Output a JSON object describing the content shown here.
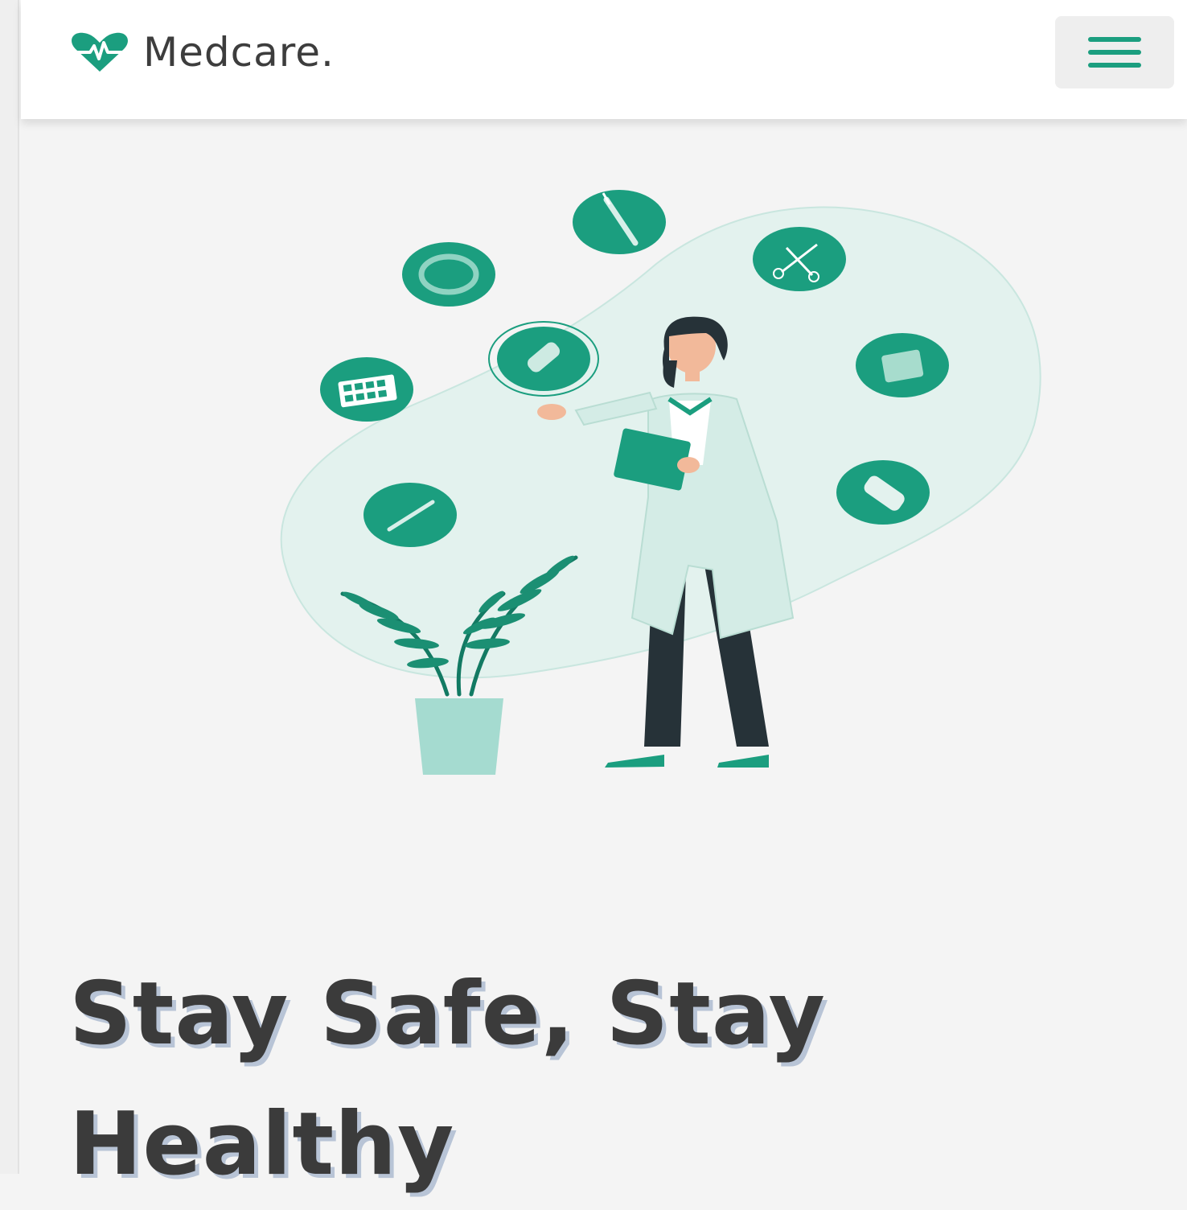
{
  "brand": {
    "name": "Medcare.",
    "icon": "heart-pulse-icon",
    "accent": "#1b9e7f"
  },
  "navbar": {
    "menu_icon": "hamburger-menu-icon"
  },
  "hero": {
    "illustration": "doctor-with-medical-items-illustration",
    "title": "Stay Safe, Stay Healthy"
  },
  "colors": {
    "accent": "#1b9e7f",
    "text": "#3b3b3b",
    "background": "#f4f4f4"
  }
}
